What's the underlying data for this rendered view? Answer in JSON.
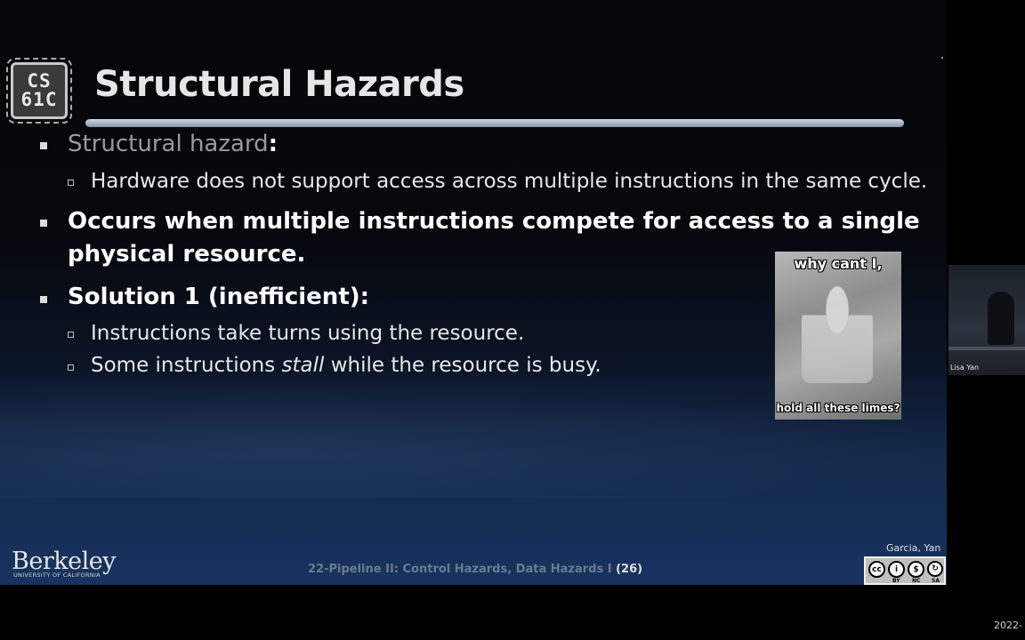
{
  "slide": {
    "logo_line1": "CS",
    "logo_line2": "61C",
    "title": "Structural Hazards",
    "bullets": [
      {
        "term": "Structural hazard",
        "colon": ":"
      },
      {
        "sub": "Hardware does not support access across multiple instructions in the same cycle."
      },
      {
        "line1": "Occurs when multiple instructions compete for access to a single",
        "line2": "physical resource."
      },
      {
        "text": "Solution 1 (inefficient):"
      },
      {
        "sub": "Instructions take turns using the resource."
      },
      {
        "pre": "Some instructions ",
        "em": "stall",
        "post": " while the resource is busy."
      }
    ],
    "meme": {
      "top_text": "why cant I,",
      "bottom_text": "hold all these limes?"
    },
    "brand": {
      "name": "Berkeley",
      "sub": "UNIVERSITY OF CALIFORNIA"
    },
    "footer": {
      "lecture": "22-Pipeline II: Control Hazards, Data Hazards I",
      "page": "(26)"
    },
    "authors": "Garcia, Yan",
    "license": {
      "labels": [
        "BY",
        "NC",
        "SA"
      ]
    }
  },
  "presenter": {
    "name": "Lisa Yan"
  },
  "timestamp": "2022-"
}
